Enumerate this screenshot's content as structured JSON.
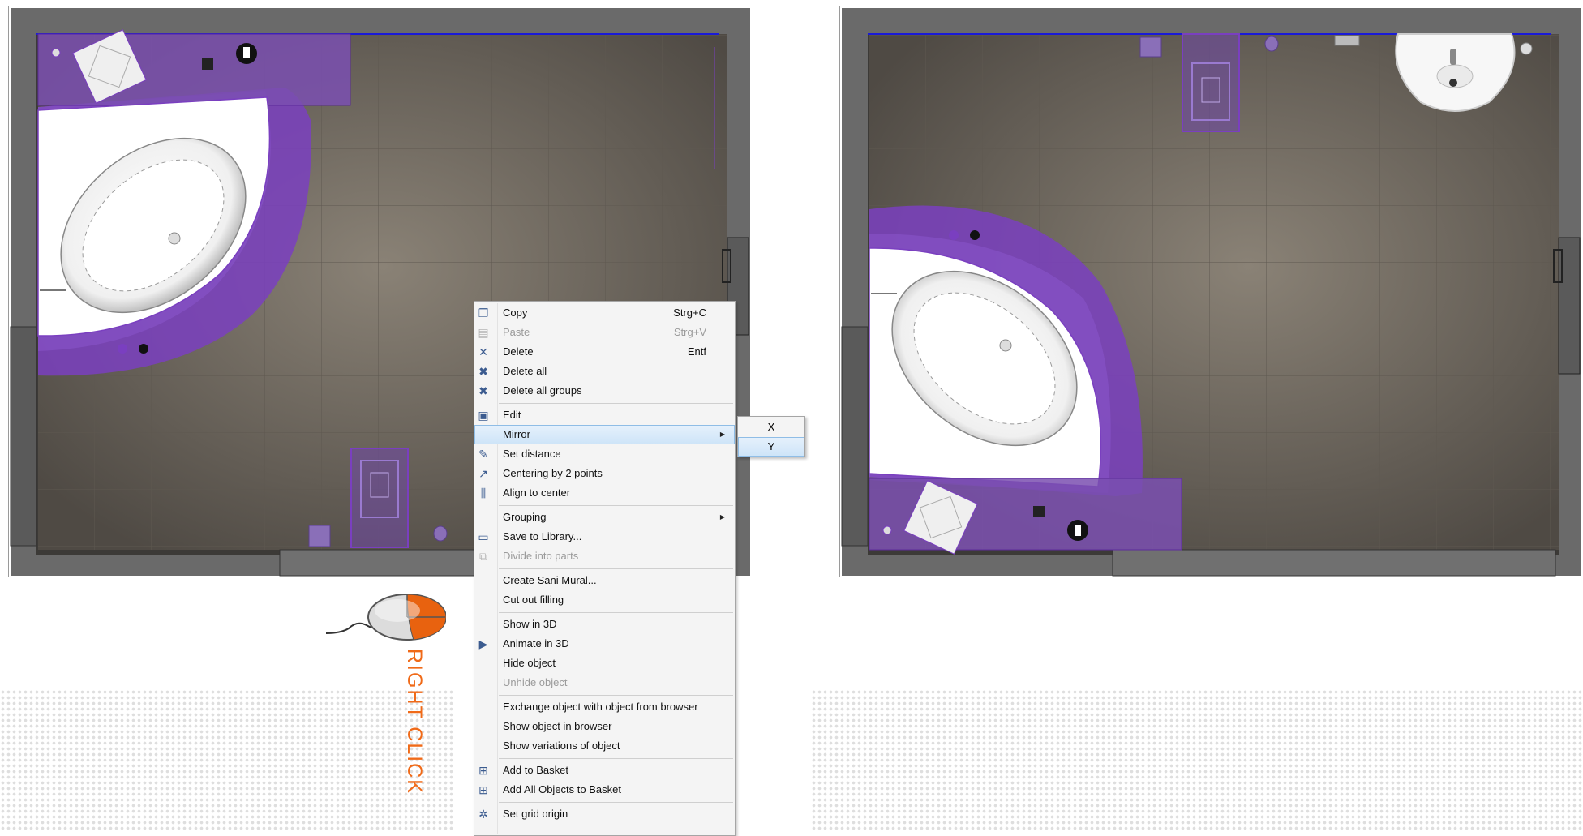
{
  "context_menu": {
    "items": [
      {
        "label": "Copy",
        "shortcut": "Strg+C",
        "icon": "copy-icon",
        "glyph": "❐",
        "disabled": false
      },
      {
        "label": "Paste",
        "shortcut": "Strg+V",
        "icon": "paste-icon",
        "glyph": "▤",
        "disabled": true
      },
      {
        "label": "Delete",
        "shortcut": "Entf",
        "icon": "delete-icon",
        "glyph": "✕",
        "disabled": false
      },
      {
        "label": "Delete all",
        "shortcut": "",
        "icon": "delete-all-icon",
        "glyph": "✖",
        "disabled": false
      },
      {
        "label": "Delete all groups",
        "shortcut": "",
        "icon": "delete-all-groups-icon",
        "glyph": "✖",
        "disabled": false
      },
      {
        "separator": true
      },
      {
        "label": "Edit",
        "shortcut": "",
        "icon": "edit-icon",
        "glyph": "▣",
        "disabled": false
      },
      {
        "label": "Mirror",
        "shortcut": "",
        "icon": "",
        "glyph": "",
        "disabled": false,
        "submenu": true,
        "highlight": true
      },
      {
        "label": "Set distance",
        "shortcut": "",
        "icon": "set-distance-icon",
        "glyph": "✎",
        "disabled": false
      },
      {
        "label": "Centering by 2 points",
        "shortcut": "",
        "icon": "centering-icon",
        "glyph": "↗",
        "disabled": false
      },
      {
        "label": "Align to center",
        "shortcut": "",
        "icon": "align-center-icon",
        "glyph": "⫼",
        "disabled": false
      },
      {
        "separator": true
      },
      {
        "label": "Grouping",
        "shortcut": "",
        "icon": "",
        "glyph": "",
        "disabled": false,
        "submenu": true
      },
      {
        "label": "Save to Library...",
        "shortcut": "",
        "icon": "save-icon",
        "glyph": "▭",
        "disabled": false
      },
      {
        "label": "Divide into parts",
        "shortcut": "",
        "icon": "divide-icon",
        "glyph": "⧉",
        "disabled": true
      },
      {
        "separator": true
      },
      {
        "label": "Create Sani Mural...",
        "shortcut": "",
        "icon": "",
        "glyph": "",
        "disabled": false
      },
      {
        "label": "Cut out filling",
        "shortcut": "",
        "icon": "",
        "glyph": "",
        "disabled": false
      },
      {
        "separator": true
      },
      {
        "label": "Show in 3D",
        "shortcut": "",
        "icon": "",
        "glyph": "",
        "disabled": false
      },
      {
        "label": "Animate in 3D",
        "shortcut": "",
        "icon": "play-icon",
        "glyph": "▶",
        "disabled": false
      },
      {
        "label": "Hide object",
        "shortcut": "",
        "icon": "",
        "glyph": "",
        "disabled": false
      },
      {
        "label": "Unhide object",
        "shortcut": "",
        "icon": "",
        "glyph": "",
        "disabled": true
      },
      {
        "separator": true
      },
      {
        "label": "Exchange object with object from browser",
        "shortcut": "",
        "icon": "",
        "glyph": "",
        "disabled": false
      },
      {
        "label": "Show object in browser",
        "shortcut": "",
        "icon": "",
        "glyph": "",
        "disabled": false
      },
      {
        "label": "Show variations of object",
        "shortcut": "",
        "icon": "",
        "glyph": "",
        "disabled": false
      },
      {
        "separator": true
      },
      {
        "label": "Add to Basket",
        "shortcut": "",
        "icon": "add-basket-icon",
        "glyph": "⊞",
        "disabled": false
      },
      {
        "label": "Add All Objects to Basket",
        "shortcut": "",
        "icon": "add-all-basket-icon",
        "glyph": "⊞",
        "disabled": false
      },
      {
        "separator": true
      },
      {
        "label": "Set grid origin",
        "shortcut": "",
        "icon": "grid-origin-icon",
        "glyph": "✲",
        "disabled": false
      }
    ]
  },
  "mirror_submenu": {
    "items": [
      {
        "label": "X",
        "highlight": false
      },
      {
        "label": "Y",
        "highlight": true
      }
    ]
  },
  "instruction": {
    "label": "RIGHT CLICK",
    "color": "#f06a18"
  },
  "colors": {
    "selection_purple": "#7a3fc0",
    "floor": "#6e675e",
    "wall": "#6d6d6d",
    "menu_highlight": "#cde4f8"
  }
}
